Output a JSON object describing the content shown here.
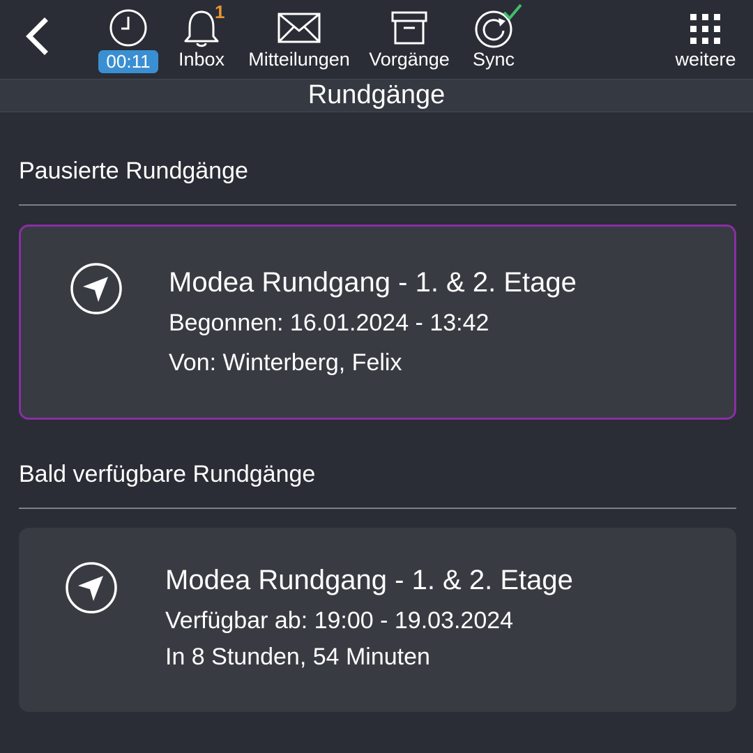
{
  "topbar": {
    "back_icon": "chevron-left-icon",
    "timer": {
      "icon": "clock-icon",
      "value": "00:11"
    },
    "inbox": {
      "icon": "bell-icon",
      "label": "Inbox",
      "count": "1"
    },
    "messages": {
      "icon": "envelope-icon",
      "label": "Mitteilungen"
    },
    "processes": {
      "icon": "archive-box-icon",
      "label": "Vorgänge"
    },
    "sync": {
      "icon": "sync-icon",
      "label": "Sync",
      "status_icon": "check-icon"
    },
    "more": {
      "icon": "grid-dots-icon",
      "label": "weitere"
    }
  },
  "page": {
    "title": "Rundgänge"
  },
  "sections": {
    "paused": {
      "heading": "Pausierte Rundgänge",
      "card": {
        "icon": "navigation-arrow-icon",
        "title": "Modea Rundgang - 1. & 2. Etage",
        "line1": "Begonnen: 16.01.2024 - 13:42",
        "line2": "Von: Winterberg, Felix"
      }
    },
    "upcoming": {
      "heading": "Bald verfügbare Rundgänge",
      "card": {
        "icon": "navigation-arrow-icon",
        "title": "Modea Rundgang - 1. & 2. Etage",
        "line1": "Verfügbar ab: 19:00 - 19.03.2024",
        "line2": "In 8 Stunden, 54 Minuten"
      }
    }
  },
  "colors": {
    "background": "#2a2d35",
    "card": "#383b42",
    "selected_border": "#8a2ea6",
    "timer_badge": "#3a8fd2",
    "badge_count": "#e8952f",
    "sync_ok": "#3fbf6b"
  }
}
